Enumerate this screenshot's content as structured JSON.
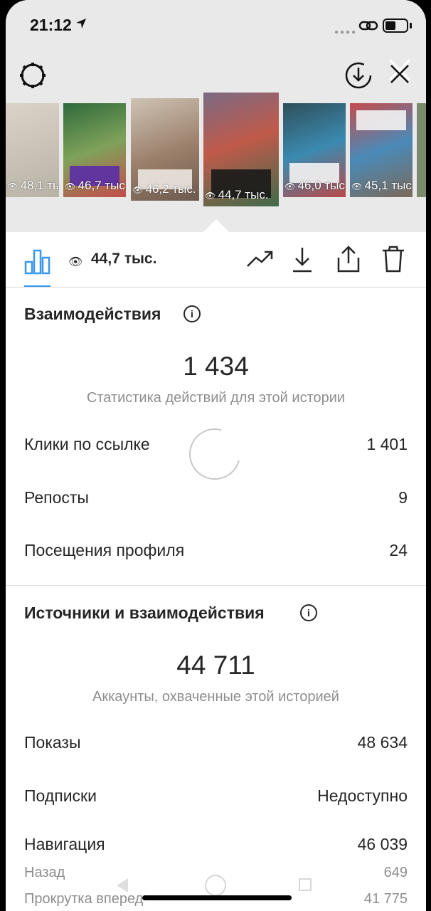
{
  "status_bar": {
    "time": "21:12"
  },
  "thumbnails": [
    {
      "label": "48,1 тыс.",
      "color": "#c9c2b7"
    },
    {
      "label": "46,7 тыс.",
      "color": "#3f7a4a"
    },
    {
      "label": "46,2 тыс.",
      "color": "#b8a897"
    },
    {
      "label": "44,7 тыс.",
      "color": "#6a5a73"
    },
    {
      "label": "46,0 тыс.",
      "color": "#2f5b78"
    },
    {
      "label": "45,1 тыс.",
      "color": "#5e7b8c"
    }
  ],
  "toolbar": {
    "views": "44,7 тыс.",
    "accent": "#3897f0"
  },
  "interactions": {
    "title": "Взаимодействия",
    "total": "1 434",
    "subtitle": "Статистика действий для этой истории",
    "rows": [
      {
        "label": "Клики по ссылке",
        "value": "1 401"
      },
      {
        "label": "Репосты",
        "value": "9"
      },
      {
        "label": "Посещения профиля",
        "value": "24"
      }
    ]
  },
  "discovery": {
    "title": "Источники и взаимодействия",
    "total": "44 711",
    "subtitle": "Аккаунты, охваченные этой историей",
    "rows": [
      {
        "label": "Показы",
        "value": "48 634"
      },
      {
        "label": "Подписки",
        "value": "Недоступно"
      },
      {
        "label": "Навигация",
        "value": "46 039"
      }
    ],
    "subrows": [
      {
        "label": "Назад",
        "value": "649"
      },
      {
        "label": "Прокрутка вперед",
        "value": "41 775"
      }
    ]
  }
}
